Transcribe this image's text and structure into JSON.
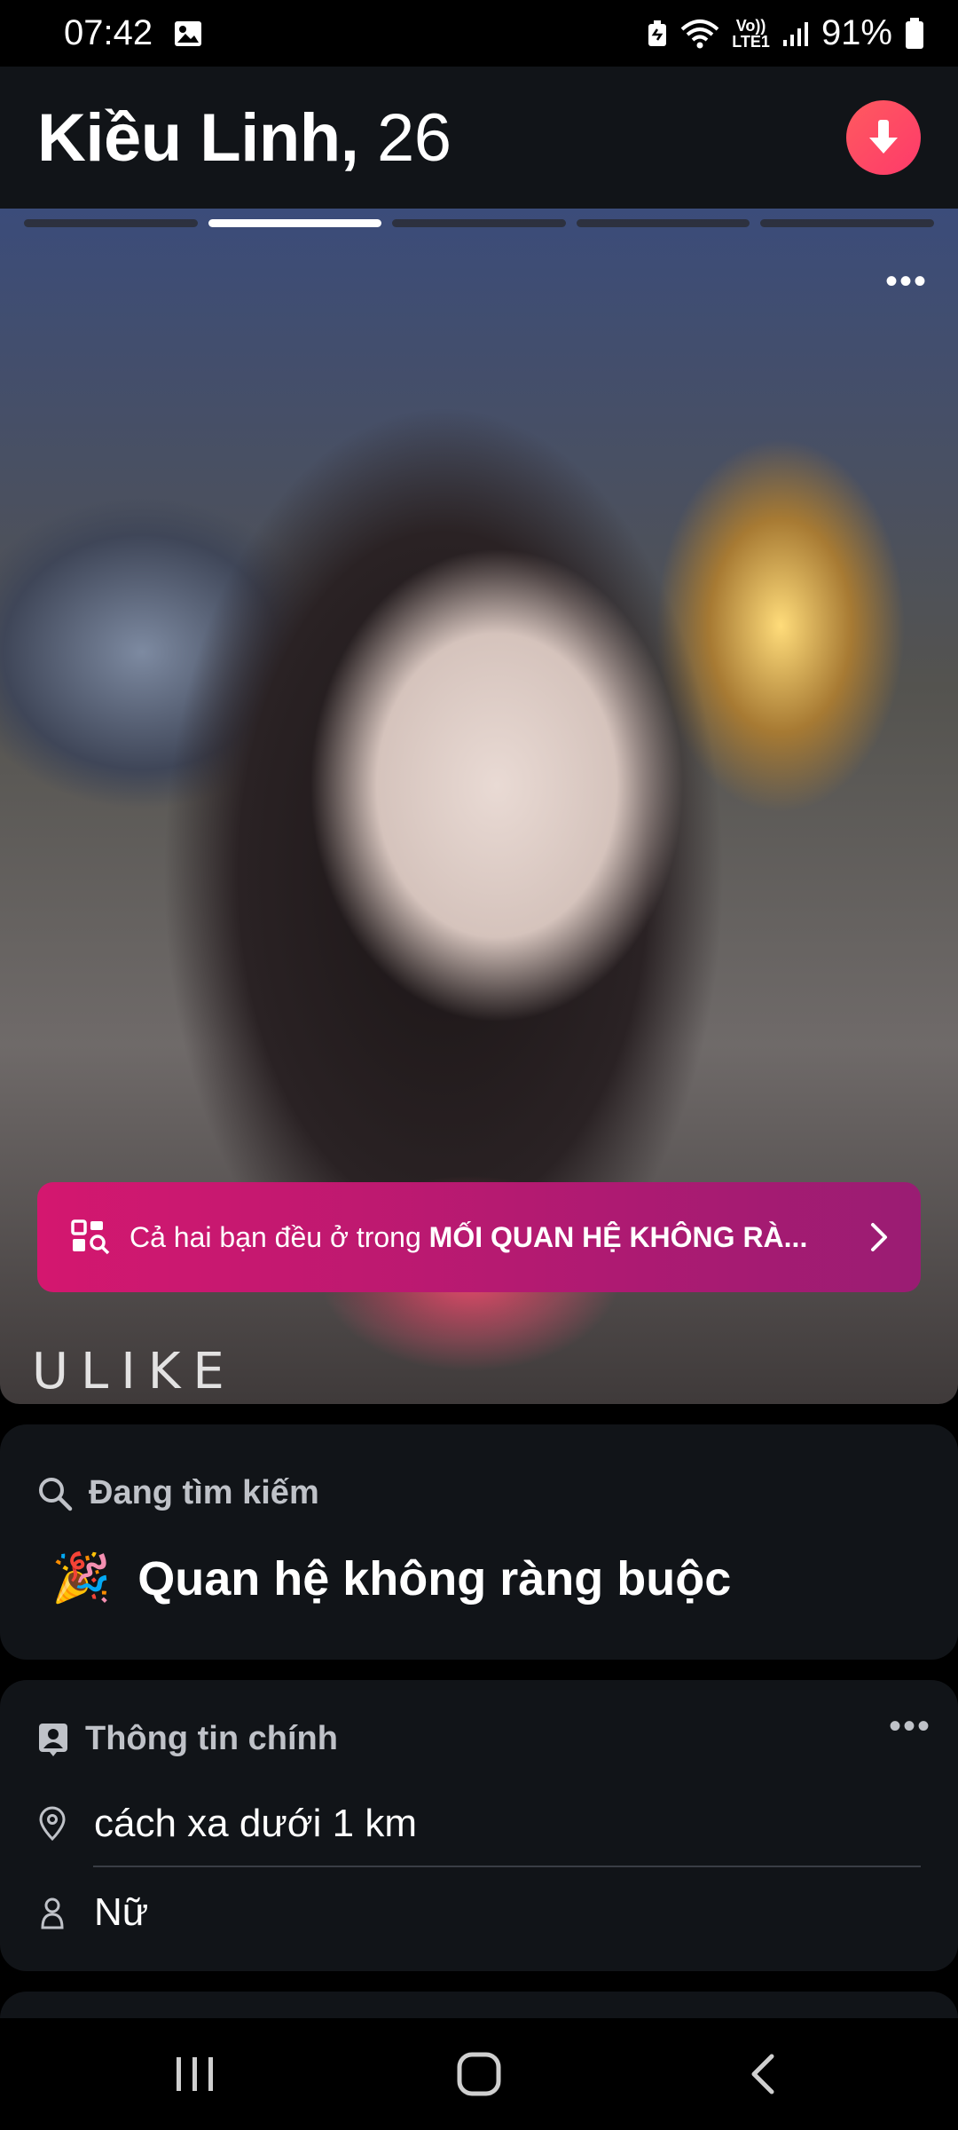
{
  "status_bar": {
    "time": "07:42",
    "network_top": "Vo))",
    "network_bottom": "LTE1",
    "battery": "91%"
  },
  "header": {
    "name": "Kiều Linh,",
    "age": "26",
    "collapse_icon": "arrow-down-icon",
    "accent_color": "#fd4a63"
  },
  "photo": {
    "total_photos": 5,
    "active_photo_index": 1,
    "watermark": "ULIKE"
  },
  "banner": {
    "text_prefix": "Cả hai bạn đều ở trong ",
    "text_highlight": "MỐI QUAN HỆ KHÔNG RÀ...",
    "icon": "search-grid-icon"
  },
  "looking_for": {
    "label": "Đang tìm kiếm",
    "emoji": "🎉",
    "value": "Quan hệ không ràng buộc"
  },
  "main_info": {
    "label": "Thông tin chính",
    "more": "•••",
    "distance": "cách xa dưới 1 km",
    "gender": "Nữ"
  }
}
